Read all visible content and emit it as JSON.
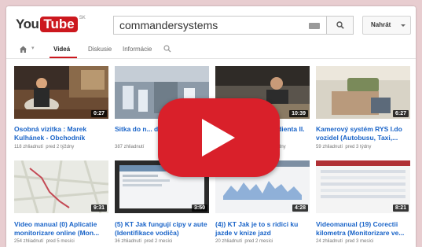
{
  "header": {
    "logo_you": "You",
    "logo_tube": "Tube",
    "logo_region": "SK",
    "search_value": "commandersystems",
    "upload_label": "Nahrát"
  },
  "tabs": [
    {
      "label": "Videá",
      "active": true
    },
    {
      "label": "Diskusie",
      "active": false
    },
    {
      "label": "Informácie",
      "active": false
    }
  ],
  "videos": [
    {
      "title": "Osobná vizitka : Marek Kulhánek - Obchodník",
      "views": "118 zhliadnutí",
      "age": "pred 2 týždny",
      "duration": "0:27"
    },
    {
      "title": "Sitka do n... darcek pro...",
      "views": "387 zhliadnutí",
      "age": "",
      "duration": ""
    },
    {
      "title": "...dienta II.",
      "views": "",
      "age": "...ýdny",
      "duration": "10:39"
    },
    {
      "title": "Kamerový systém RYS I.do vozidel (Autobusu, Taxi,...",
      "views": "59 zhliadnutí",
      "age": "pred 3 týdny",
      "duration": "6:27"
    },
    {
      "title": "Video manual (0) Aplicatie monitorizare online (Mon...",
      "views": "254 zhliadnutí",
      "age": "pred 5 mesíci",
      "duration": "9:31"
    },
    {
      "title": "(5) KT Jak fungují cipy v aute (Identifikace vodiča)",
      "views": "36 zhliadnutí",
      "age": "pred 2 mesíci",
      "duration": "3:50"
    },
    {
      "title": "(4)) KT Jak je to s ridici ku jazde v knize jazd",
      "views": "20 zhliadnutí",
      "age": "pred 2 mesíci",
      "duration": "4:28"
    },
    {
      "title": "Videomanual (19) Corectii kilometra (Monitorizare ve...",
      "views": "24 zhliadnutí",
      "age": "pred 3 mesíci",
      "duration": "8:21"
    }
  ],
  "colors": {
    "accent": "#cc181e",
    "link": "#1a64c8",
    "play": "#d9202a"
  },
  "icons": [
    "home-icon",
    "search-icon",
    "keyboard-icon",
    "play-icon"
  ]
}
